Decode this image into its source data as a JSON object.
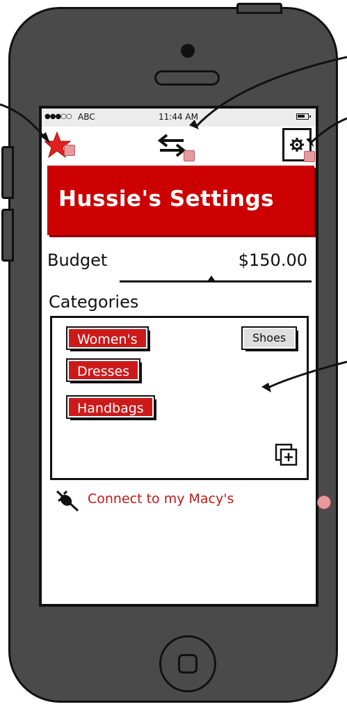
{
  "status_bar": {
    "signal": "●●●○○",
    "carrier": "ABC",
    "time": "11:44 AM"
  },
  "nav": {
    "left_icon": "star-icon",
    "center_icon": "swap-arrows-icon",
    "right_icon": "gear-icon"
  },
  "header": {
    "title": "Hussie's Settings"
  },
  "budget": {
    "label": "Budget",
    "value": "$150.00",
    "slider_fraction": 0.48
  },
  "categories": {
    "label": "Categories",
    "tags": [
      {
        "label": "Women's"
      },
      {
        "label": "Shoes"
      },
      {
        "label": "Dresses"
      },
      {
        "label": "Handbags"
      }
    ],
    "add_icon": "add-copy-icon"
  },
  "connect": {
    "label": "Connect to my Macy's",
    "icon": "plug-icon"
  },
  "colors": {
    "brand_red": "#cc0000",
    "tag_red": "#cc1a1a",
    "link_red": "#c01818",
    "phone_body": "#4a4a4a"
  }
}
